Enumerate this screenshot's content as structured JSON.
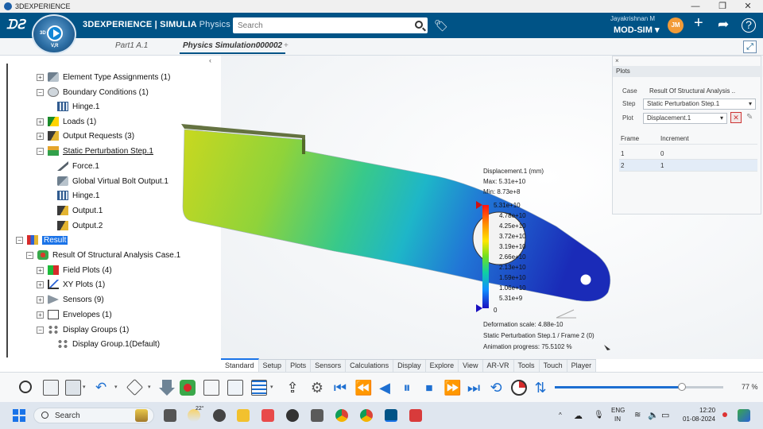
{
  "window": {
    "title": "3DEXPERIENCE",
    "minimize": "—",
    "maximize": "❐",
    "close": "✕"
  },
  "header": {
    "brand_bold": "3DEXPERIENCE | SIMULIA",
    "brand_light": "Physics R...",
    "compass_label": "V,R",
    "compass_3d": "3D",
    "search_placeholder": "Search",
    "user_name": "Jayakrishnan M",
    "role": "MOD-SIM",
    "role_caret": "▾",
    "avatar_initials": "JM",
    "colors": {
      "bar": "#005386",
      "avatar": "#f29b38"
    }
  },
  "tabs": [
    {
      "label": "Part1 A.1"
    },
    {
      "label": "Physics Simulation000002"
    }
  ],
  "tab_add": "+",
  "tree": {
    "items": [
      {
        "label": "Element Type Assignments (1)"
      },
      {
        "label": "Boundary Conditions (1)"
      },
      {
        "label": "Hinge.1"
      },
      {
        "label": "Loads (1)"
      },
      {
        "label": "Output Requests (3)"
      },
      {
        "label": "Static Perturbation Step.1"
      },
      {
        "label": "Force.1"
      },
      {
        "label": "Global Virtual Bolt Output.1"
      },
      {
        "label": "Hinge.1"
      },
      {
        "label": "Output.1"
      },
      {
        "label": "Output.2"
      },
      {
        "label": "Result"
      },
      {
        "label": "Result Of Structural Analysis Case.1"
      },
      {
        "label": "Field Plots (4)"
      },
      {
        "label": "XY Plots (1)"
      },
      {
        "label": "Sensors (9)"
      },
      {
        "label": "Envelopes (1)"
      },
      {
        "label": "Display Groups (1)"
      },
      {
        "label": "Display Group.1(Default)"
      }
    ],
    "expand_symbol": "+",
    "collapse_symbol": "−"
  },
  "legend": {
    "title": "Displacement.1 (mm)",
    "max": "Max: 5.31e+10",
    "min": "Min: 8.73e+8",
    "ticks": [
      "5.31e+10",
      "4.78e+10",
      "4.25e+10",
      "3.72e+10",
      "3.19e+10",
      "2.66e+10",
      "2.13e+10",
      "1.59e+10",
      "1.06e+10",
      "5.31e+9",
      "0"
    ],
    "deformation": "Deformation scale: 4.88e-10",
    "frame": "Static Perturbation Step.1 / Frame 2 (0)",
    "animation": "Animation progress: 75.5102 %"
  },
  "plots_panel": {
    "tab": "Plots",
    "case_label": "Case",
    "case_value": "Result Of Structural Analysis ..",
    "step_label": "Step",
    "step_value": "Static Perturbation Step.1",
    "plot_label": "Plot",
    "plot_value": "Displacement.1",
    "columns": [
      "Frame",
      "Increment"
    ],
    "rows": [
      {
        "frame": "1",
        "increment": "0"
      },
      {
        "frame": "2",
        "increment": "1"
      }
    ]
  },
  "action_tabs": [
    "Standard",
    "Setup",
    "Plots",
    "Sensors",
    "Calculations",
    "Display",
    "Explore",
    "View",
    "AR-VR",
    "Tools",
    "Touch",
    "Player"
  ],
  "player": {
    "progress": 0.755,
    "zoom": "77 %"
  },
  "taskbar": {
    "search": "Search",
    "weather": "22°",
    "lang": "ENG",
    "region": "IN",
    "time": "12:20",
    "date": "01-08-2024"
  }
}
